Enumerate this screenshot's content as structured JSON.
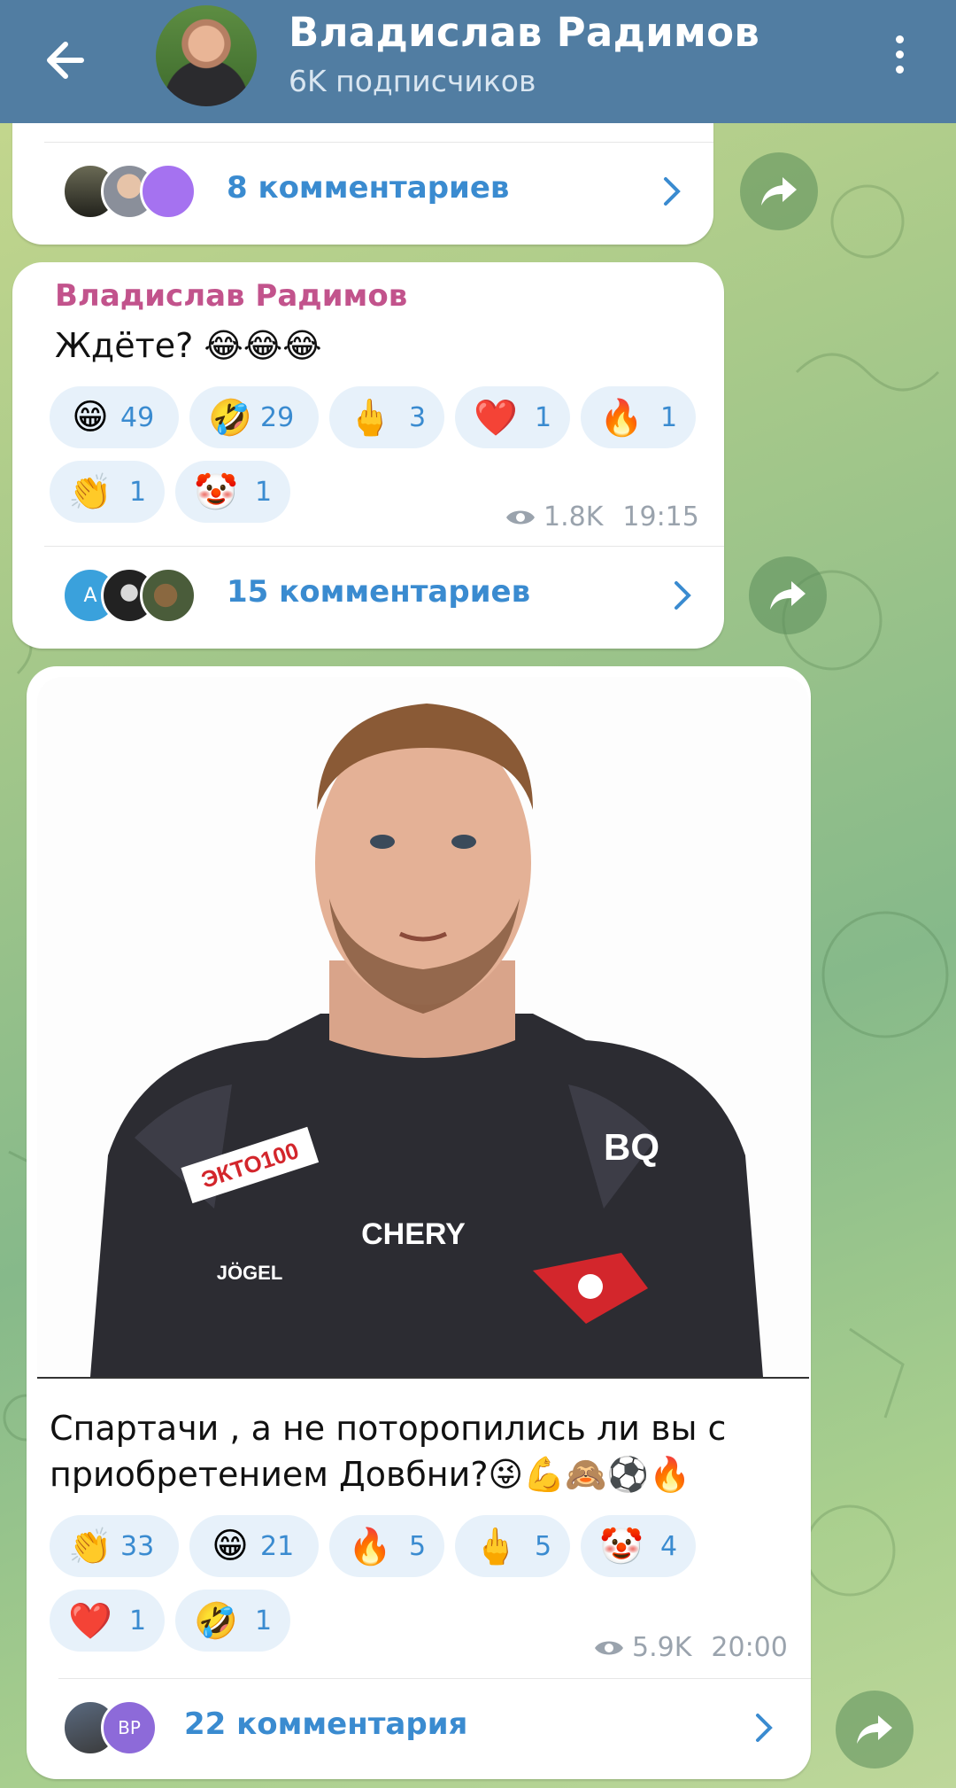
{
  "header": {
    "title": "Владислав Радимов",
    "subtitle": "6K подписчиков"
  },
  "post1": {
    "comments_label": "8 комментариев"
  },
  "post2": {
    "author": "Владислав Радимов",
    "text": "Ждёте? 😂😂😂",
    "reactions": [
      {
        "emoji": "😁",
        "count": "49"
      },
      {
        "emoji": "🤣",
        "count": "29"
      },
      {
        "emoji": "🖕",
        "count": "3"
      },
      {
        "emoji": "❤️",
        "count": "1"
      },
      {
        "emoji": "🔥",
        "count": "1"
      },
      {
        "emoji": "👏",
        "count": "1"
      },
      {
        "emoji": "🤡",
        "count": "1"
      }
    ],
    "views": "1.8K",
    "time": "19:15",
    "comments_label": "15 комментариев",
    "commenter_initial": "A"
  },
  "post3": {
    "text": "Спартачи , а не поторопились ли вы с приобретением Довбни?😜💪🙈⚽🔥",
    "photo_texts": {
      "sponsor1": "ЭКТО100",
      "sponsor2": "BQ",
      "brand": "CHERY",
      "kit": "JÖGEL"
    },
    "reactions": [
      {
        "emoji": "👏",
        "count": "33"
      },
      {
        "emoji": "😁",
        "count": "21"
      },
      {
        "emoji": "🔥",
        "count": "5"
      },
      {
        "emoji": "🖕",
        "count": "5"
      },
      {
        "emoji": "🤡",
        "count": "4"
      },
      {
        "emoji": "❤️",
        "count": "1"
      },
      {
        "emoji": "🤣",
        "count": "1"
      }
    ],
    "views": "5.9K",
    "time": "20:00",
    "comments_label": "22 комментария",
    "commenter_initials": "ВР"
  },
  "colors": {
    "header_bg": "#517da2",
    "link": "#3a8bd0",
    "author": "#c2538c",
    "reaction_bg": "#e7f1fa"
  }
}
